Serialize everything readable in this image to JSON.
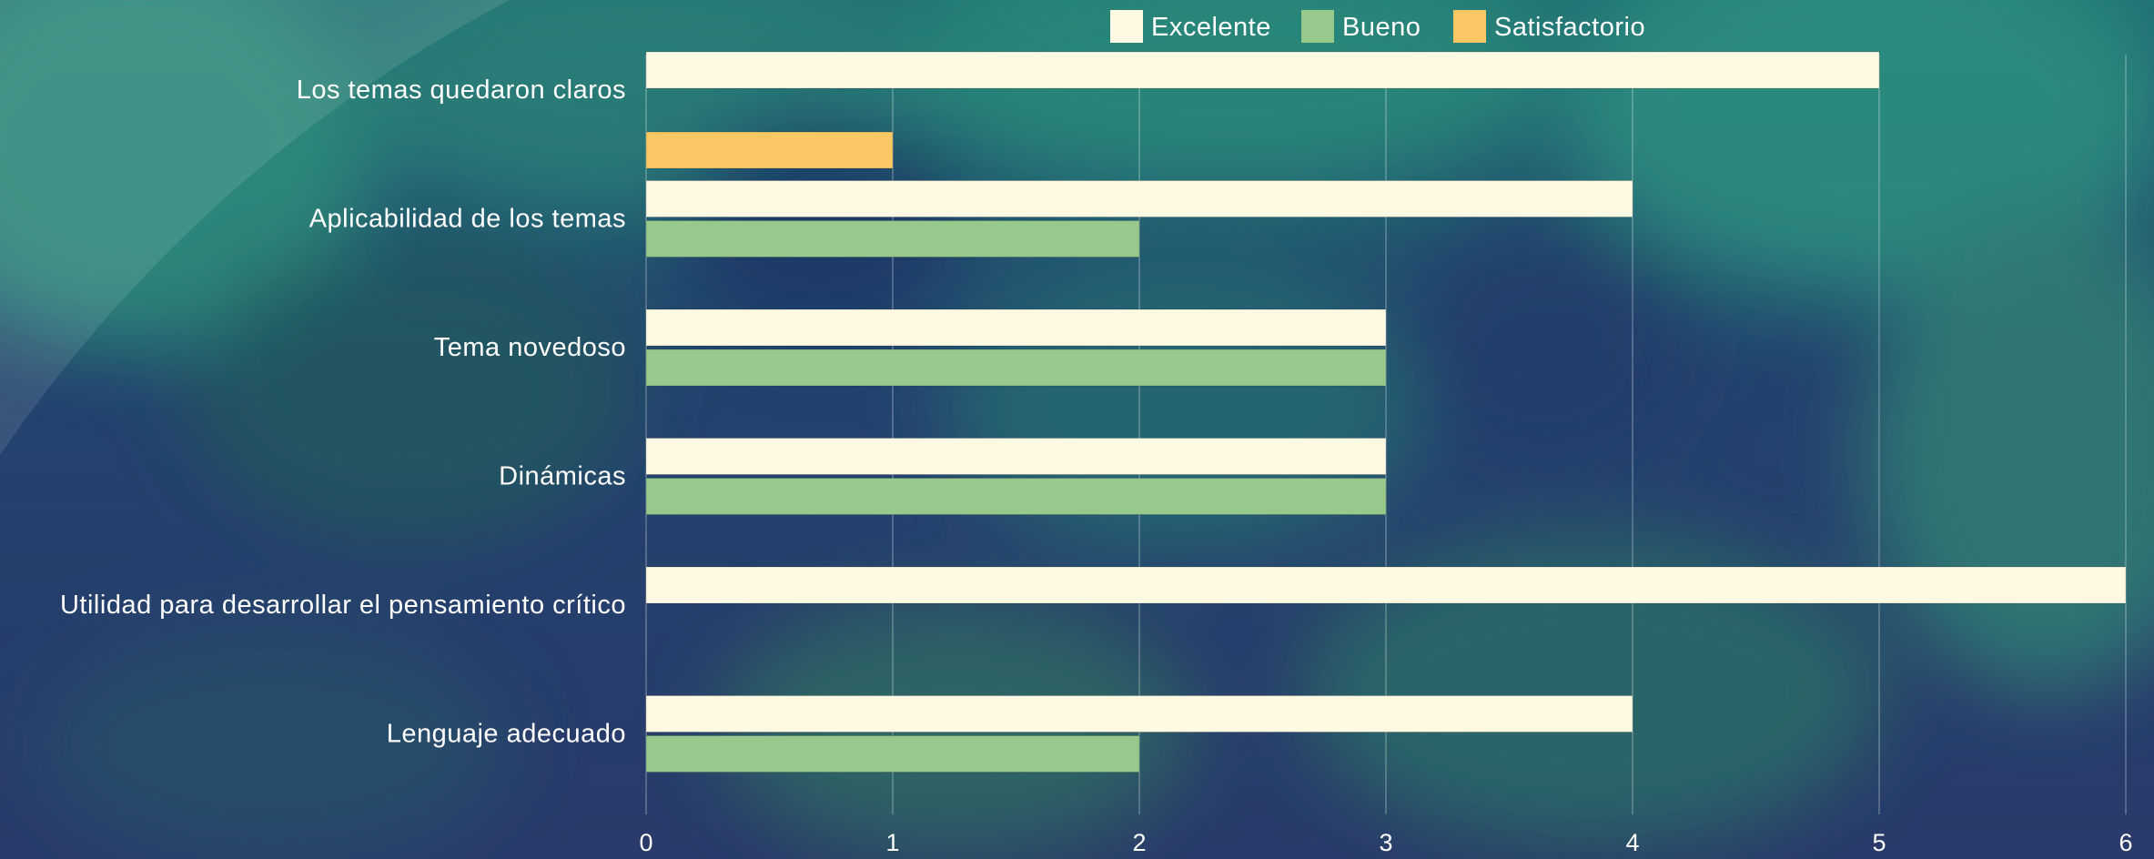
{
  "colors": {
    "excelente": "#fdf9e3",
    "bueno": "#97c98c",
    "satisfactorio": "#f9c864",
    "background": "#1f3f66"
  },
  "chart_data": {
    "type": "bar",
    "orientation": "horizontal",
    "categories": [
      "Los temas quedaron claros",
      "Aplicabilidad de los temas",
      "Tema novedoso",
      "Dinámicas",
      "Utilidad para desarrollar el pensamiento crítico",
      "Lenguaje adecuado"
    ],
    "series": [
      {
        "name": "Excelente",
        "color": "#fdf9e3",
        "values": [
          5,
          4,
          3,
          3,
          6,
          4
        ]
      },
      {
        "name": "Bueno",
        "color": "#97c98c",
        "values": [
          0,
          2,
          3,
          3,
          0,
          2
        ]
      },
      {
        "name": "Satisfactorio",
        "color": "#f9c864",
        "values": [
          1,
          0,
          0,
          0,
          0,
          0
        ]
      }
    ],
    "xlim": [
      0,
      6
    ],
    "xticks": [
      "0",
      "1",
      "2",
      "3",
      "4",
      "5",
      "6"
    ],
    "grid": true,
    "legend": "top-center"
  }
}
